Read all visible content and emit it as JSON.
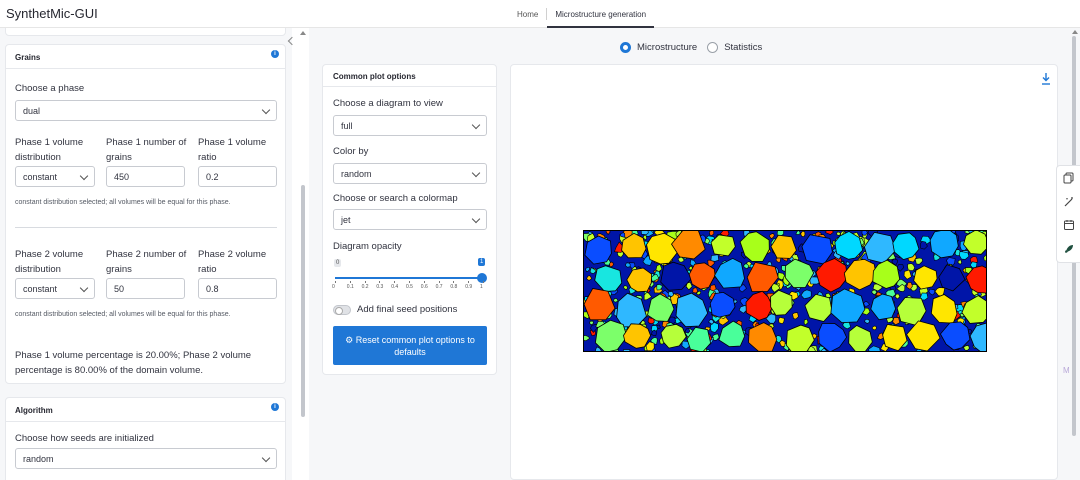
{
  "app": {
    "title": "SynthetMic-GUI"
  },
  "nav": {
    "home": "Home",
    "active": "Microstructure generation"
  },
  "grains": {
    "title": "Grains",
    "phase_label": "Choose a phase",
    "phase_value": "dual",
    "p1_dist_label": "Phase 1 volume distribution",
    "p1_grains_label": "Phase 1 number of grains",
    "p1_ratio_label": "Phase 1 volume ratio",
    "p1_dist_value": "constant",
    "p1_grains_value": "450",
    "p1_ratio_value": "0.2",
    "p1_note": "constant distribution selected; all volumes will be equal for this phase.",
    "p2_dist_label": "Phase 2 volume distribution",
    "p2_grains_label": "Phase 2 number of grains",
    "p2_ratio_label": "Phase 2 volume ratio",
    "p2_dist_value": "constant",
    "p2_grains_value": "50",
    "p2_ratio_value": "0.8",
    "p2_note": "constant distribution selected; all volumes will be equal for this phase.",
    "summary": "Phase 1 volume percentage is 20.00%; Phase 2 volume percentage is 80.00% of the domain volume."
  },
  "algorithm": {
    "title": "Algorithm",
    "seeds_label": "Choose how seeds are initialized",
    "seeds_value": "random"
  },
  "view": {
    "option_microstructure": "Microstructure",
    "option_statistics": "Statistics",
    "selected": "Microstructure"
  },
  "plot_options": {
    "title": "Common plot options",
    "diagram_label": "Choose a diagram to view",
    "diagram_value": "full",
    "color_label": "Color by",
    "color_value": "random",
    "colormap_label": "Choose or search a colormap",
    "colormap_value": "jet",
    "opacity_label": "Diagram opacity",
    "opacity_min": "0",
    "opacity_max": "1",
    "opacity_value": 1,
    "ticks": [
      "0",
      "0.1",
      "0.2",
      "0.3",
      "0.4",
      "0.5",
      "0.6",
      "0.7",
      "0.8",
      "0.9",
      "1"
    ],
    "seed_toggle_label": "Add final seed positions",
    "seed_toggle_on": false,
    "reset_label": "Reset common plot options to defaults"
  },
  "icons": {
    "info": "info-icon",
    "download": "download-icon",
    "gear": "gear-icon",
    "copy": "copy-icon",
    "magic": "magic-wand-icon",
    "calendar": "calendar-icon",
    "rocket": "rocket-icon"
  },
  "colors": {
    "accent": "#1f77d6",
    "text": "#31333f",
    "sidebar_bg": "#f6f7f9"
  }
}
